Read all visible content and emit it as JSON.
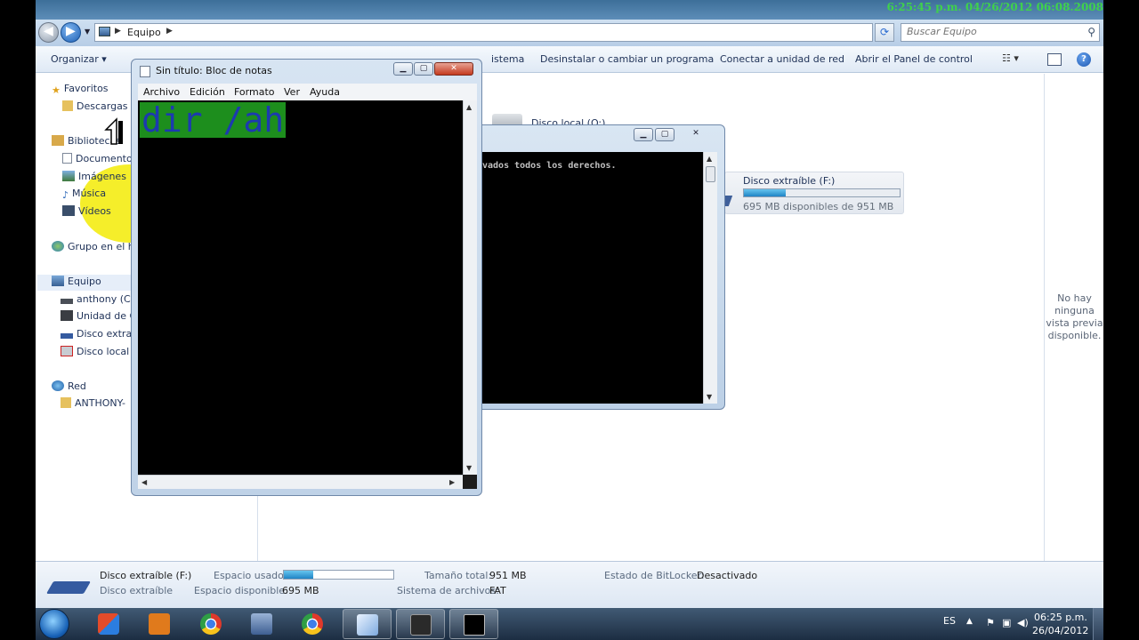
{
  "overlay_clock": "6:25:45 p.m. 04/26/2012 06:08.2008",
  "address": {
    "location": "Equipo"
  },
  "search": {
    "placeholder": "Buscar Equipo"
  },
  "commands": {
    "organize": "Organizar",
    "uninstall": "Desinstalar o cambiar un programa",
    "map_drive": "Conectar a unidad de red",
    "control_panel": "Abrir el Panel de control",
    "system_tail": "istema"
  },
  "nav": {
    "favorites": "Favoritos",
    "downloads": "Descargas",
    "libraries": "Bibliotecas",
    "documents": "Documento",
    "images": "Imágenes",
    "music": "Música",
    "videos": "Vídeos",
    "homegroup": "Grupo en el h",
    "computer": "Equipo",
    "drive_c": "anthony (C:",
    "drive_d": "Unidad de C",
    "drive_f": "Disco extraíl",
    "drive_o": "Disco local (",
    "network": "Red",
    "network_pc": "ANTHONY-"
  },
  "content": {
    "disk_local_label": "Disco local (O:)",
    "removable_label": "Disco extraíble (F:)",
    "removable_free": "695 MB disponibles de 951 MB",
    "removable_used_fraction": 0.27
  },
  "preview": {
    "no_preview": "No hay ninguna vista previa disponible."
  },
  "details": {
    "name": "Disco extraíble (F:)",
    "type": "Disco extraíble",
    "used_label": "Espacio usado:",
    "used_fraction": 0.27,
    "free_label": "Espacio disponible:",
    "free_value": "695 MB",
    "total_label": "Tamaño total:",
    "total_value": "951 MB",
    "fs_label": "Sistema de archivos:",
    "fs_value": "FAT",
    "bitlocker_label": "Estado de BitLocker:",
    "bitlocker_value": "Desactivado"
  },
  "cmd": {
    "text": "vados todos los derechos."
  },
  "notepad": {
    "title": "Sin título: Bloc de notas",
    "menu": [
      "Archivo",
      "Edición",
      "Formato",
      "Ver",
      "Ayuda"
    ],
    "text": "dir /ah",
    "text_color": "#1c3ab0",
    "highlight_color": "#1d8e1d"
  },
  "taskbar": {
    "lang": "ES",
    "time": "06:25 p.m.",
    "date": "26/04/2012"
  }
}
